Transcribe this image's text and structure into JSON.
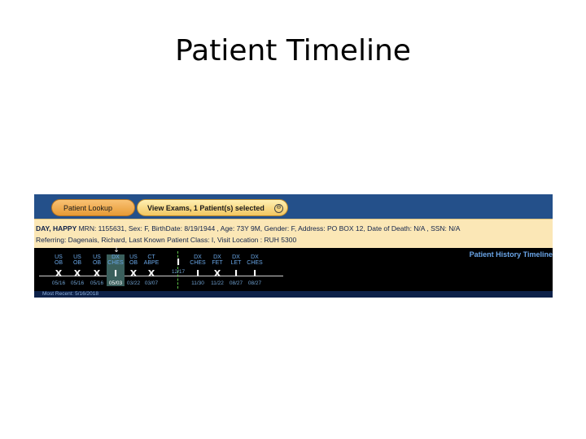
{
  "slide": {
    "title": "Patient Timeline"
  },
  "tabs": {
    "lookup_label": "Patient Lookup",
    "exams_label": "View Exams, 1 Patient(s) selected",
    "close_glyph": "⊖"
  },
  "patient": {
    "name": "DAY, HAPPY",
    "line1_rest": " MRN: 1155631, Sex: F, BirthDate: 8/19/1944 , Age: 73Y 9M, Gender: F, Address: PO BOX 12, Date of Death: N/A , SSN: N/A",
    "line2": "Referring: Dagenais, Richard, Last Known Patient Class: I, Visit Location : RUH 5300"
  },
  "timeline": {
    "title": "Patient History Timeline",
    "selection_arrow": "↓",
    "exams": [
      {
        "modality": "US",
        "type": "OB",
        "mark": "X",
        "date": "05/16"
      },
      {
        "modality": "US",
        "type": "OB",
        "mark": "X",
        "date": "05/16"
      },
      {
        "modality": "US",
        "type": "OB",
        "mark": "X",
        "date": "05/16"
      },
      {
        "modality": "DX",
        "type": "CHES",
        "mark": "I",
        "date": "05/03"
      },
      {
        "modality": "US",
        "type": "OB",
        "mark": "X",
        "date": "03/22"
      },
      {
        "modality": "CT",
        "type": "ABPE",
        "mark": "X",
        "date": "03/07"
      },
      {
        "modality": "",
        "type": "",
        "mark": "I",
        "date": "12/17"
      },
      {
        "modality": "DX",
        "type": "CHES",
        "mark": "I",
        "date": "11/30"
      },
      {
        "modality": "DX",
        "type": "FET",
        "mark": "X",
        "date": "11/22"
      },
      {
        "modality": "DX",
        "type": "LET",
        "mark": "I",
        "date": "08/27"
      },
      {
        "modality": "DX",
        "type": "CHES",
        "mark": "I",
        "date": "08/27"
      }
    ]
  },
  "footer": {
    "most_recent": "Most Recent: 5/16/2018"
  },
  "colors": {
    "tab_lookup": "#e79a35",
    "tab_active": "#f2c660",
    "info_bg": "#fbe7b6",
    "timeline_bg": "#000000",
    "timeline_title": "#6aa5e8",
    "app_frame": "#1d3f74"
  }
}
